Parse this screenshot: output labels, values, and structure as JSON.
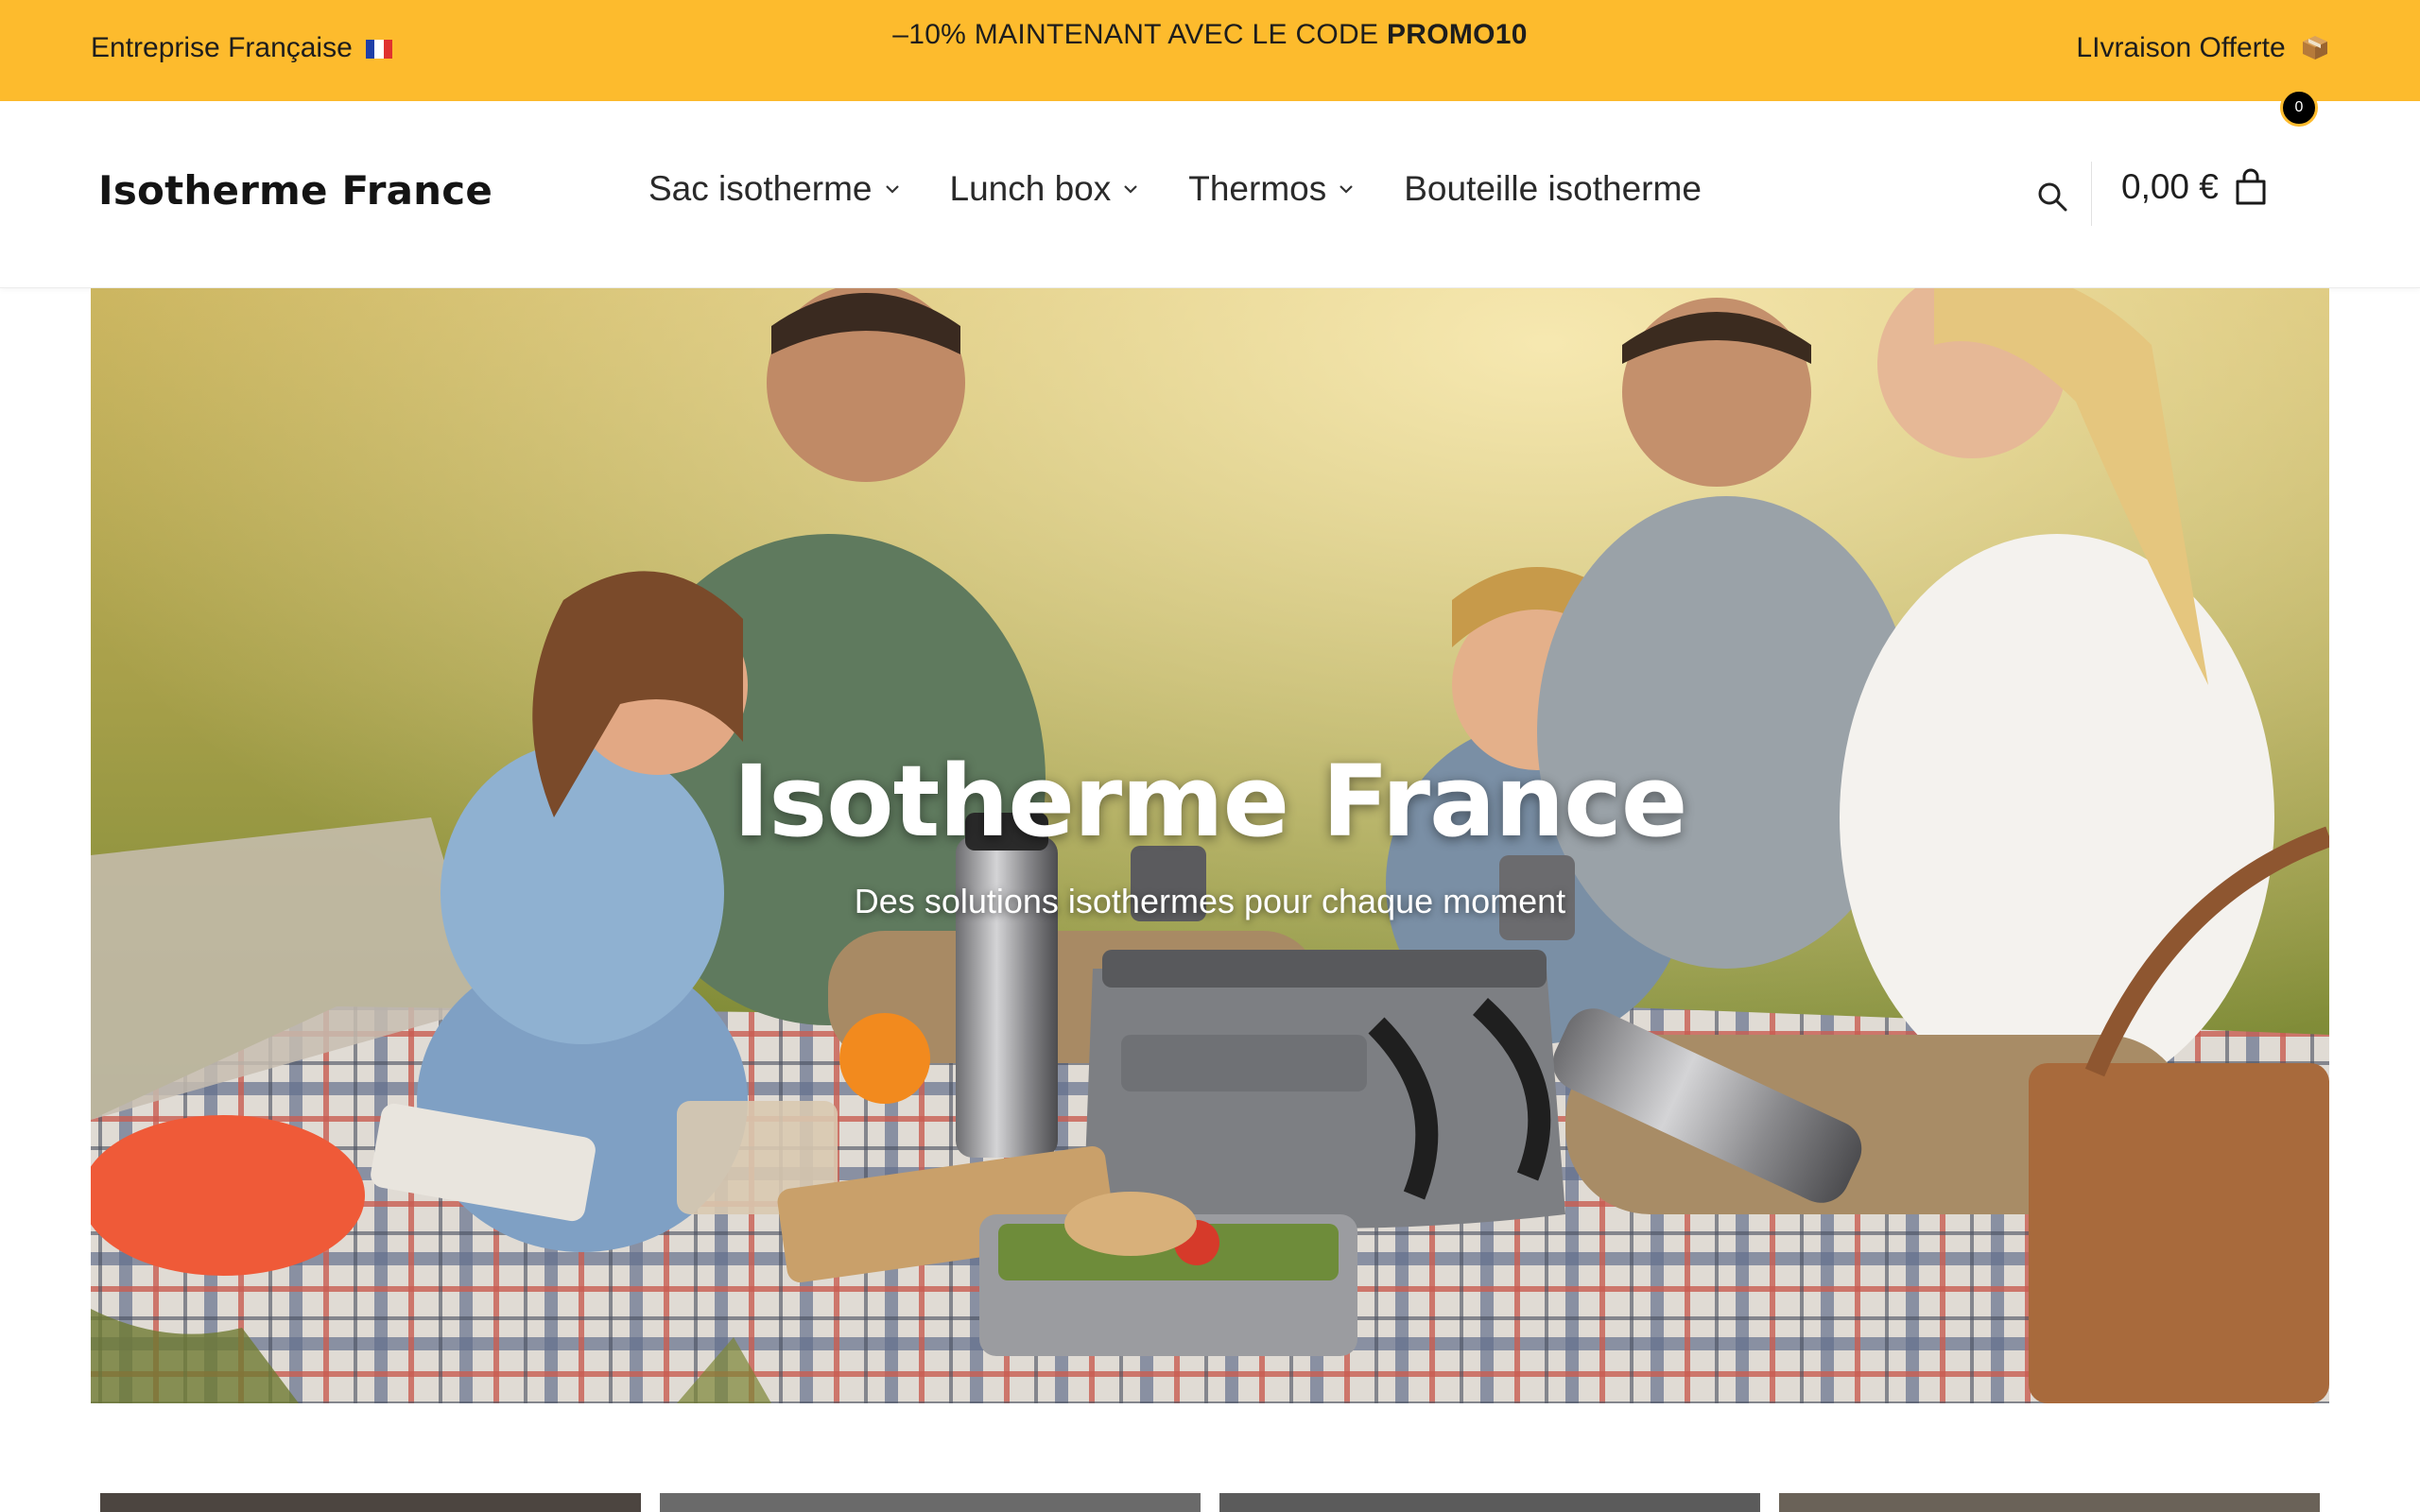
{
  "topbar": {
    "left_text": "Entreprise Française",
    "left_icon": "french-flag-icon",
    "center_prefix": "–10% MAINTENANT AVEC LE CODE ",
    "center_code": "PROMO10",
    "right_text": "LIvraison Offerte",
    "right_icon": "package-icon",
    "color": "#fdbb2d"
  },
  "header": {
    "logo": "Isotherme France",
    "nav": [
      {
        "label": "Sac isotherme",
        "has_dropdown": true
      },
      {
        "label": "Lunch box",
        "has_dropdown": true
      },
      {
        "label": "Thermos",
        "has_dropdown": true
      },
      {
        "label": "Bouteille isotherme",
        "has_dropdown": false
      }
    ],
    "search_icon": "search-icon",
    "cart_total": "0,00 €",
    "cart_icon": "shopping-bag-icon",
    "cart_count": "0"
  },
  "hero": {
    "title": "Isotherme France",
    "subtitle": "Des solutions isothermes pour chaque moment",
    "image_icon": "family-picnic-image"
  },
  "categories": {
    "card_colors": [
      "#4c4540",
      "#6a6a6a",
      "#5b5b5b",
      "#6a6258"
    ]
  }
}
